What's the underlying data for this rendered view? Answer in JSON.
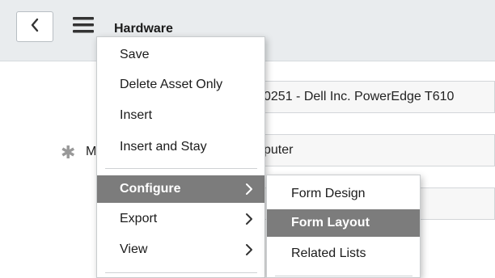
{
  "header": {
    "title": "Hardware"
  },
  "form": {
    "asset_value": "0251 - Dell Inc. PowerEdge T610",
    "label_fragment": "M",
    "model_category_value": "puter"
  },
  "context_menu": {
    "items": [
      {
        "label": "Save"
      },
      {
        "label": "Delete Asset Only"
      },
      {
        "label": "Insert"
      },
      {
        "label": "Insert and Stay"
      },
      {
        "label": "Configure",
        "has_submenu": true,
        "active": true
      },
      {
        "label": "Export",
        "has_submenu": true
      },
      {
        "label": "View",
        "has_submenu": true
      }
    ]
  },
  "submenu": {
    "items": [
      {
        "label": "Form Design"
      },
      {
        "label": "Form Layout",
        "active": true
      },
      {
        "label": "Related Lists"
      }
    ]
  },
  "colors": {
    "active_bg": "#7c7c7c",
    "header_bg": "#e9ecee"
  },
  "icons": {
    "back": "chevron-left-icon",
    "menu": "hamburger-menu-icon",
    "required": "asterisk-icon",
    "submenu_arrow": "chevron-right-icon"
  }
}
